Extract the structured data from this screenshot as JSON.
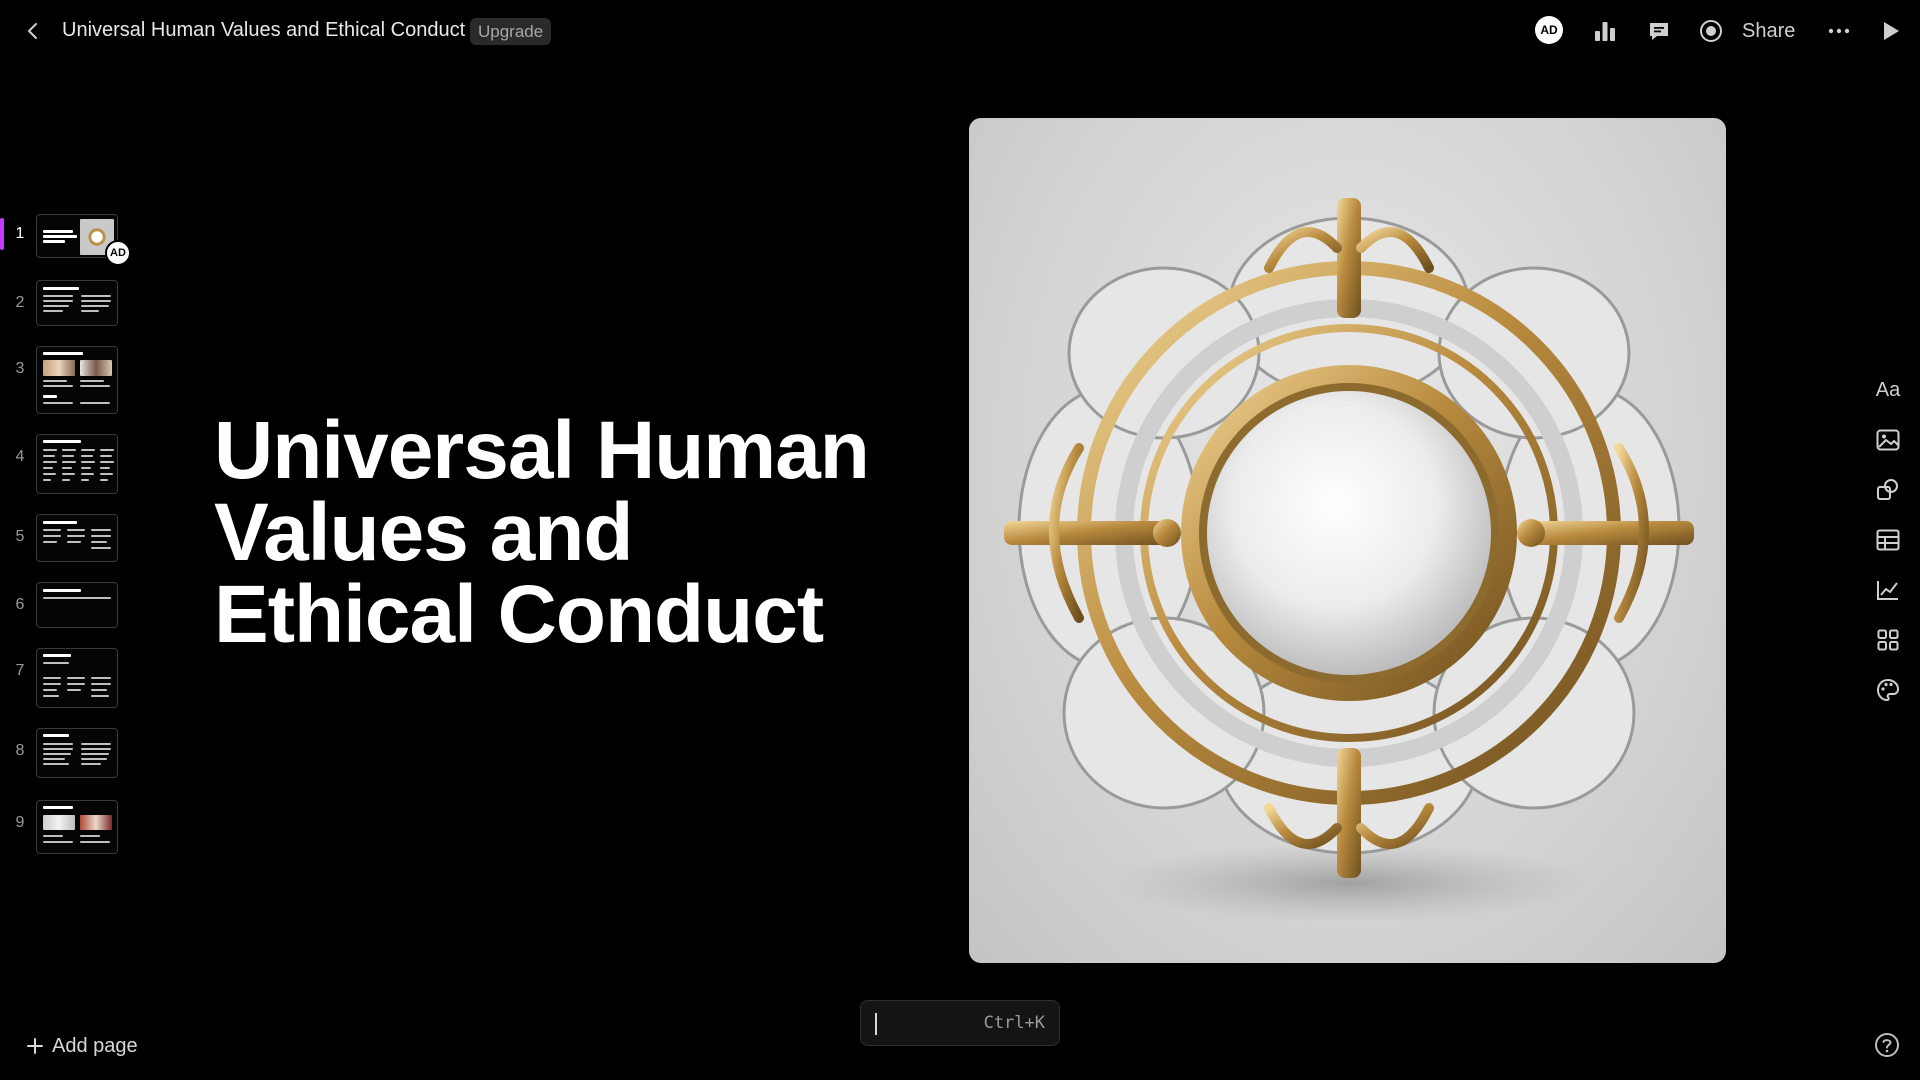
{
  "header": {
    "title": "Universal Human Values and Ethical Conduct",
    "upgrade_label": "Upgrade",
    "avatar_initials": "AD",
    "share_label": "Share"
  },
  "pages": {
    "numbers": [
      "1",
      "2",
      "3",
      "4",
      "5",
      "6",
      "7",
      "8",
      "9"
    ],
    "active_page": 1,
    "thumb_avatar_initials": "AD",
    "add_page_label": "Add page",
    "active_color": "#c13cff"
  },
  "slide": {
    "title": "Universal Human Values and Ethical Conduct",
    "image_icon": "ornate-gold-pearl-brooch"
  },
  "toolbar": {
    "text_style_label": "Aa",
    "icons": [
      "text-style-icon",
      "image-icon",
      "shapes-icon",
      "table-icon",
      "chart-icon",
      "apps-icon",
      "palette-icon"
    ]
  },
  "command_bar": {
    "shortcut": "Ctrl+K"
  }
}
